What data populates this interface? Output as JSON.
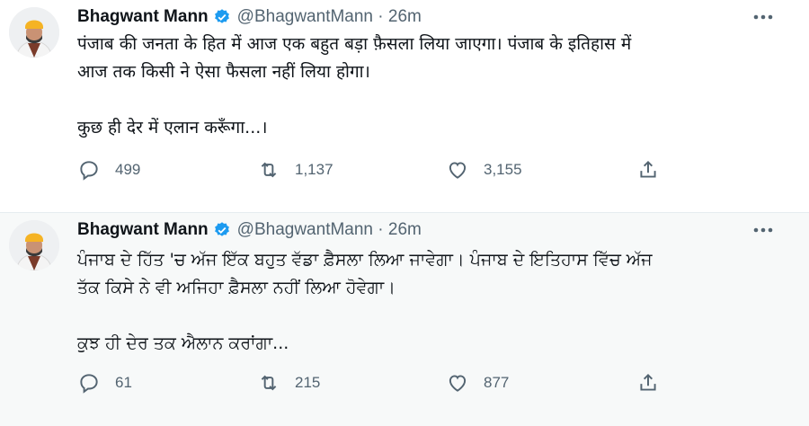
{
  "tweets": [
    {
      "name": "Bhagwant Mann",
      "handle_time": "@BhagwantMann · 26m",
      "text_line1": "पंजाब की जनता के हित में आज एक बहुत बड़ा फ़ैसला लिया जाएगा। पंजाब के इतिहास में",
      "text_line2": "आज तक किसी ने ऐसा फैसला नहीं लिया होगा।",
      "text_line3": "",
      "text_line4": "कुछ ही देर में एलान करूँगा...।",
      "replies": "499",
      "retweets": "1,137",
      "likes": "3,155"
    },
    {
      "name": "Bhagwant Mann",
      "handle_time": "@BhagwantMann · 26m",
      "text_line1": "ਪੰਜਾਬ ਦੇ ਹਿੱਤ 'ਚ ਅੱਜ ਇੱਕ ਬਹੁਤ ਵੱਡਾ ਫ਼ੈਸਲਾ ਲਿਆ ਜਾਵੇਗਾ। ਪੰਜਾਬ ਦੇ ਇਤਿਹਾਸ ਵਿੱਚ ਅੱਜ",
      "text_line2": "ਤੱਕ ਕਿਸੇ ਨੇ ਵੀ ਅਜਿਹਾ ਫ਼ੈਸਲਾ ਨਹੀਂ ਲਿਆ ਹੋਵੇਗਾ।",
      "text_line3": "",
      "text_line4": "ਕੁਝ ਹੀ ਦੇਰ ਤਕ ਐਲਾਨ ਕਰਾਂਗਾ...",
      "replies": "61",
      "retweets": "215",
      "likes": "877"
    }
  ],
  "colors": {
    "verified": "#1d9bf0",
    "secondary": "#536471",
    "turban": "#f5b324"
  },
  "icons": [
    "reply-icon",
    "retweet-icon",
    "like-icon",
    "share-icon",
    "verified-icon",
    "more-icon"
  ]
}
